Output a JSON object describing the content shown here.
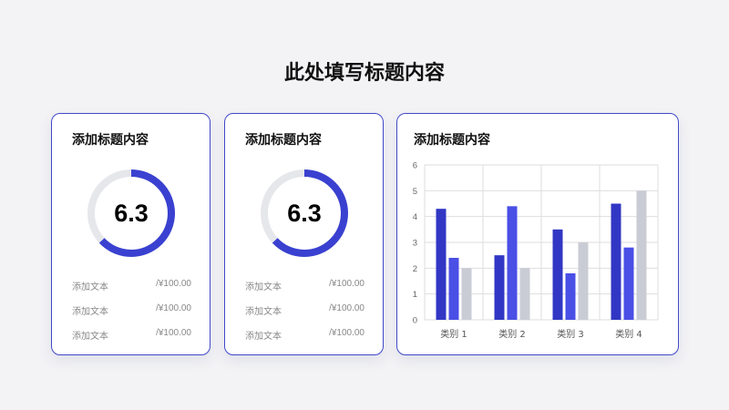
{
  "page": {
    "title": "此处填写标题内容"
  },
  "cards": [
    {
      "title": "添加标题内容",
      "value": "6.3",
      "progress": 0.63,
      "rows": [
        {
          "label": "添加文本",
          "amount": "/¥100.00"
        },
        {
          "label": "添加文本",
          "amount": "/¥100.00"
        },
        {
          "label": "添加文本",
          "amount": "/¥100.00"
        }
      ]
    },
    {
      "title": "添加标题内容",
      "value": "6.3",
      "progress": 0.63,
      "rows": [
        {
          "label": "添加文本",
          "amount": "/¥100.00"
        },
        {
          "label": "添加文本",
          "amount": "/¥100.00"
        },
        {
          "label": "添加文本",
          "amount": "/¥100.00"
        }
      ]
    }
  ],
  "chart_card": {
    "title": "添加标题内容"
  },
  "chart_data": {
    "type": "bar",
    "title": "",
    "xlabel": "",
    "ylabel": "",
    "categories": [
      "类别 1",
      "类别 2",
      "类别 3",
      "类别 4"
    ],
    "series": [
      {
        "values": [
          4.3,
          2.5,
          3.5,
          4.5
        ],
        "color": "#3137c4"
      },
      {
        "values": [
          2.4,
          4.4,
          1.8,
          2.8
        ],
        "color": "#4a4fe6"
      },
      {
        "values": [
          2.0,
          2.0,
          3.0,
          5.0
        ],
        "color": "#c9ccd4"
      }
    ],
    "ylim": [
      0,
      6
    ],
    "yticks": [
      "0",
      "1",
      "2",
      "3",
      "4",
      "5",
      "6"
    ],
    "grid": true
  },
  "colors": {
    "accent": "#3a41d0",
    "track": "#e6e7eb",
    "border": "#4149c9",
    "grid": "#dedede"
  }
}
